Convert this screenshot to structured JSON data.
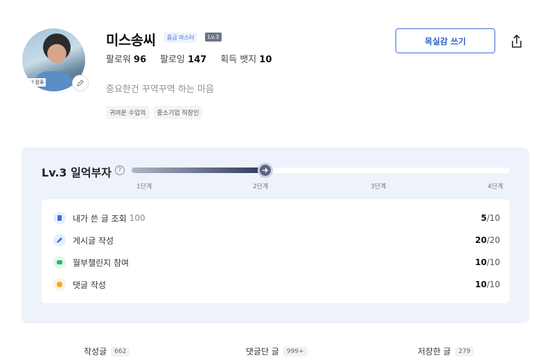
{
  "profile": {
    "name": "미스송씨",
    "rank": "중급 마스터",
    "level_badge": "Lv.3",
    "followers_label": "팔로워",
    "followers": "96",
    "following_label": "팔로잉",
    "following": "147",
    "badges_label": "획득 뱃지",
    "badges": "10",
    "bio": "중요한건 꾸역꾸역 하는 마음",
    "tags": [
      "귀여운 수입의",
      "중소기업 직장인"
    ],
    "avatar_caption": "너 컴퓨"
  },
  "actions": {
    "write_label": "목실감 쓰기",
    "share_icon": "share-icon"
  },
  "level": {
    "title": "Lv.3 일억부자",
    "help": "?",
    "progress": 0.35,
    "stages": [
      "1단계",
      "2단계",
      "3단계",
      "4단계"
    ]
  },
  "tasks": [
    {
      "label": "내가 쓴 글 조회",
      "sub": "100",
      "done": "5",
      "total": "/10",
      "icon": "document-icon",
      "color": "#3d6fd8"
    },
    {
      "label": "게시글 작성",
      "sub": "",
      "done": "20",
      "total": "/20",
      "icon": "pencil-icon",
      "color": "#3d6fd8"
    },
    {
      "label": "월부챌린지 참여",
      "sub": "",
      "done": "10",
      "total": "/10",
      "icon": "chat-icon",
      "color": "#2bb673"
    },
    {
      "label": "댓글 작성",
      "sub": "",
      "done": "10",
      "total": "/10",
      "icon": "comment-icon",
      "color": "#f5a623"
    }
  ],
  "tabs": [
    {
      "label": "작성글",
      "count": "662"
    },
    {
      "label": "댓글단 글",
      "count": "999+"
    },
    {
      "label": "저장한 글",
      "count": "279"
    }
  ]
}
